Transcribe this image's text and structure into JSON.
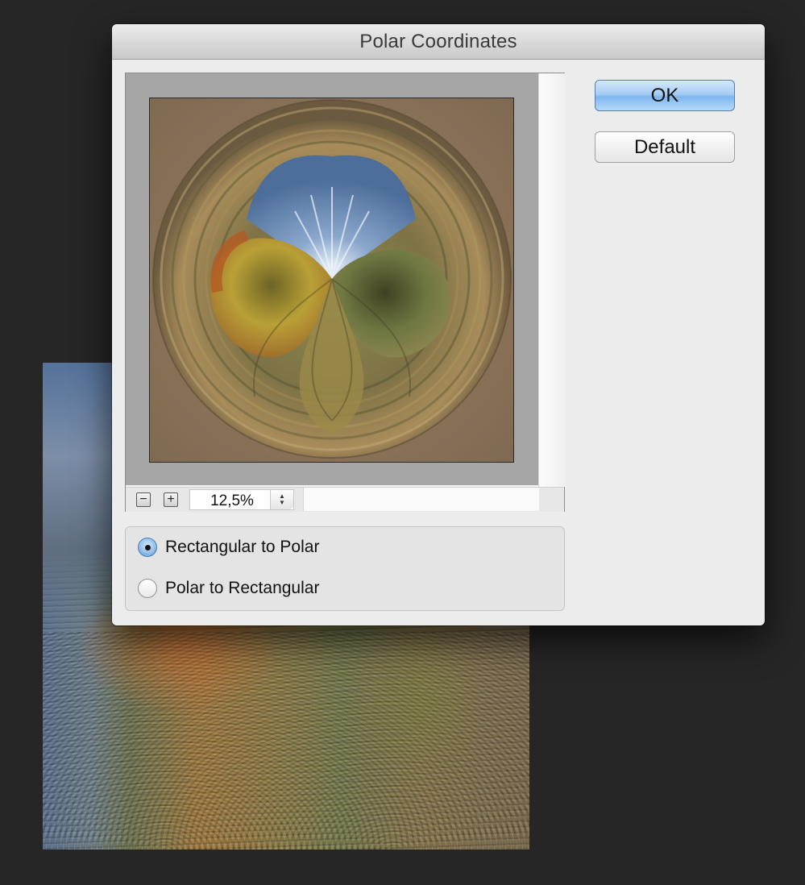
{
  "dialog": {
    "title": "Polar Coordinates",
    "ok_label": "OK",
    "default_label": "Default"
  },
  "preview": {
    "zoom_minus_glyph": "−",
    "zoom_plus_glyph": "+",
    "zoom_level": "12,5%",
    "stepper_up_glyph": "▲",
    "stepper_down_glyph": "▼"
  },
  "options": {
    "rect_to_polar_label": "Rectangular to Polar",
    "polar_to_rect_label": "Polar to Rectangular",
    "selected": "Rectangular to Polar"
  },
  "colors": {
    "accent": "#7fb6ee",
    "background": "#262626",
    "dialog": "#ececec"
  },
  "icons": {
    "zoom_out": "zoom-out-icon",
    "zoom_in": "zoom-in-icon",
    "stepper": "stepper-arrows-icon"
  }
}
